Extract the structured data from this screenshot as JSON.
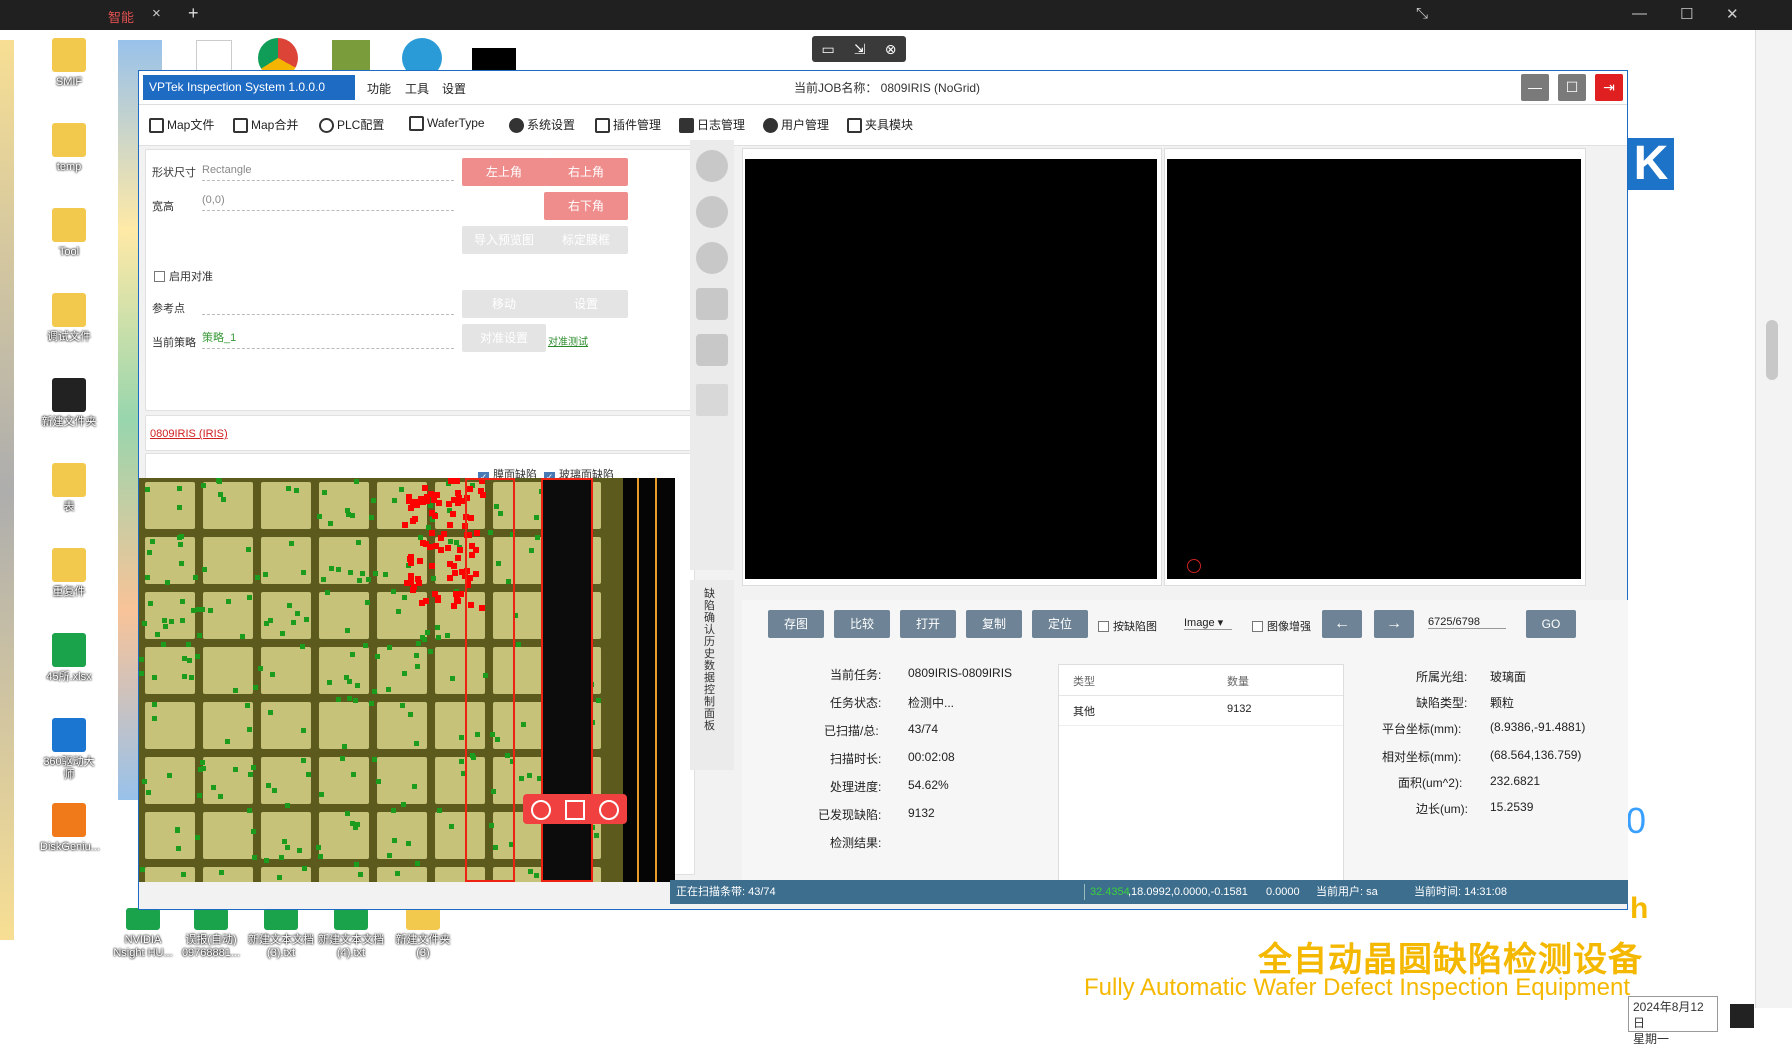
{
  "remote": {
    "tab_label": "智能",
    "tab_close": "×",
    "new_tab": "+",
    "win_controls": {
      "fullscreen": "⤡",
      "minimize": "—",
      "maximize": "☐",
      "close": "✕"
    },
    "tools": {
      "screen": "▭",
      "send": "⇲",
      "close": "⊗"
    }
  },
  "desktop": {
    "icons": [
      {
        "label": "SMIF",
        "color": "#f2c94c"
      },
      {
        "label": "temp",
        "color": "#f2c94c"
      },
      {
        "label": "Tool",
        "color": "#f2c94c"
      },
      {
        "label": "调试文件",
        "color": "#f2c94c"
      },
      {
        "label": "新建文件夹",
        "color": "#222222"
      },
      {
        "label": "表",
        "color": "#f2c94c"
      },
      {
        "label": "重复件",
        "color": "#f2c94c"
      },
      {
        "label": "45所.xlsx",
        "color": "#1aa34a"
      },
      {
        "label": "360驱动大师",
        "color": "#1b76d1"
      },
      {
        "label": "DiskGeniu...",
        "color": "#f07a1a"
      }
    ],
    "bottom_icons": [
      {
        "label": "NVIDIA Nsight HU...",
        "color": "#1aa34a"
      },
      {
        "label": "误报(自动) 09768881...",
        "color": "#1aa34a"
      },
      {
        "label": "新建文本文档 (3).txt",
        "color": "#1aa34a"
      },
      {
        "label": "新建文本文档 (4).txt",
        "color": "#1aa34a"
      },
      {
        "label": "新建文件夹 (3)",
        "color": "#f2c94c"
      }
    ],
    "ad_cn": "全自动晶圆缺陷检测设备",
    "ad_en": "Fully Automatic Wafer Defect Inspection Equipment",
    "ad_logo": "K",
    "ad_h": "h",
    "ad_zero": "0",
    "date": "2024年8月12日",
    "weekday": "星期一"
  },
  "app": {
    "title": "VPTek Inspection System 1.0.0.0",
    "menus": [
      "功能",
      "工具",
      "设置"
    ],
    "job_name": "当前JOB名称： 0809IRIS (NoGrid)",
    "buttons": {
      "minimize": "—",
      "restore": "☐",
      "exit": "⇥"
    },
    "toolbar": [
      "Map文件",
      "Map合并",
      "PLC配置",
      "WaferType",
      "系统设置",
      "插件管理",
      "日志管理",
      "用户管理",
      "夹具模块"
    ],
    "left": {
      "shape_label": "形状尺寸",
      "shape_value": "Rectangle",
      "width_label": "宽高",
      "width_value": "(0,0)",
      "btn_top_left": "左上角",
      "btn_top_right": "右上角",
      "btn_bottom_right": "右下角",
      "btn_import": "导入预览图",
      "btn_calib": "标定膜框",
      "enable_align": "启用对准",
      "ref_label": "参考点",
      "btn_move": "移动",
      "btn_set": "设置",
      "strategy_label": "当前策略",
      "strategy_value": "策略_1",
      "btn_align_set": "对准设置",
      "align_test": "对准测试",
      "job_link": "0809IRIS (IRIS)",
      "cb_film": "膜面缺陷",
      "cb_glass": "玻璃面缺陷"
    },
    "side_tabs": "缺陷确认 历史数据 控制面板",
    "bottom": {
      "btn_save": "存图",
      "btn_compare": "比较",
      "btn_open": "打开",
      "btn_copy": "复制",
      "btn_locate": "定位",
      "cb_defect": "按缺陷图",
      "image_select": "Image",
      "cb_enhance": "图像增强",
      "prev": "←",
      "next": "→",
      "page": "6725/6798",
      "go": "GO",
      "task_label": "当前任务:",
      "task_value": "0809IRIS-0809IRIS",
      "state_label": "任务状态:",
      "state_value": "检测中...",
      "scanned_label": "已扫描/总:",
      "scanned_value": "43/74",
      "time_label": "扫描时长:",
      "time_value": "00:02:08",
      "progress_label": "处理进度:",
      "progress_value": "54.62%",
      "found_label": "已发现缺陷:",
      "found_value": "9132",
      "result_label": "检测结果:",
      "result_value": "",
      "table_headers": [
        "类型",
        "数量"
      ],
      "table_rows": [
        [
          "其他",
          "9132"
        ]
      ],
      "layer_label": "所属光组:",
      "layer_value": "玻璃面",
      "dtype_label": "缺陷类型:",
      "dtype_value": "颗粒",
      "platform_label": "平台坐标(mm):",
      "platform_value": "(8.9386,-91.4881)",
      "relative_label": "相对坐标(mm):",
      "relative_value": "(68.564,136.759)",
      "area_label": "面积(um^2):",
      "area_value": "232.6821",
      "edge_label": "边长(um):",
      "edge_value": "15.2539"
    },
    "status": {
      "scanning": "正在扫描条带: 43/74",
      "coord_hi": "32.4354",
      "coord": ",18.0992,0.0000,-0.1581",
      "val": "0.0000",
      "user": "当前用户: sa",
      "time": "当前时间: 14:31:08"
    }
  }
}
